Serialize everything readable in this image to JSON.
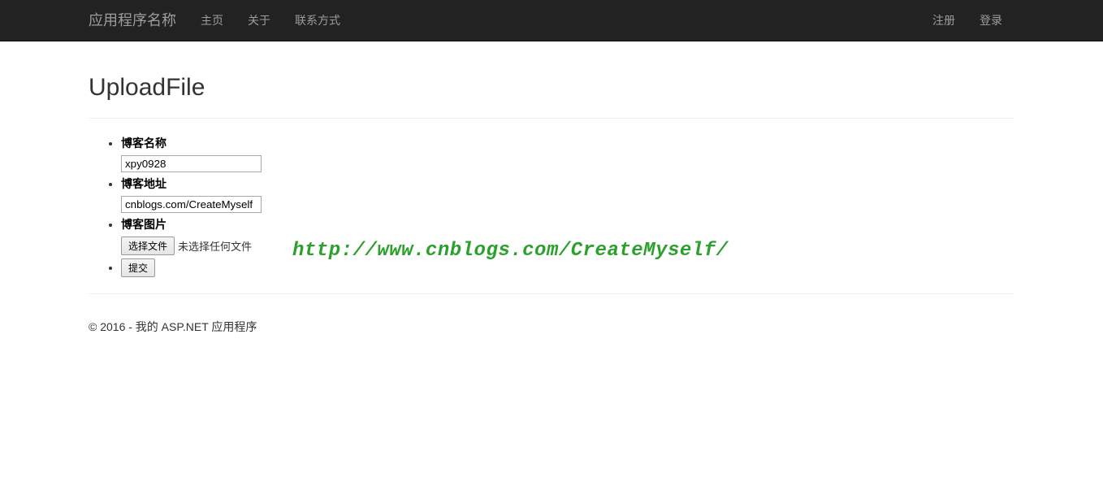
{
  "navbar": {
    "brand": "应用程序名称",
    "links_left": [
      "主页",
      "关于",
      "联系方式"
    ],
    "links_right": [
      "注册",
      "登录"
    ]
  },
  "page": {
    "title": "UploadFile"
  },
  "form": {
    "blog_name_label": "博客名称",
    "blog_name_value": "xpy0928",
    "blog_url_label": "博客地址",
    "blog_url_value": "cnblogs.com/CreateMyself",
    "blog_image_label": "博客图片",
    "file_button": "选择文件",
    "file_status": "未选择任何文件",
    "submit": "提交"
  },
  "watermark": "http://www.cnblogs.com/CreateMyself/",
  "footer": {
    "text": "© 2016 - 我的 ASP.NET 应用程序"
  }
}
